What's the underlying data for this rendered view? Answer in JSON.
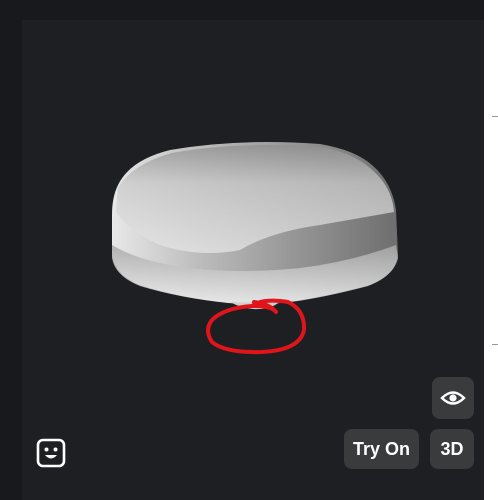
{
  "viewer": {
    "buttons": {
      "try_on_label": "Try On",
      "three_d_label": "3D"
    },
    "icons": {
      "view_toggle": "eye-icon",
      "emote": "smiley-face-icon"
    },
    "colors": {
      "background": "#1e1f23",
      "button_bg": "#393b3d",
      "annotation": "#e0151b",
      "model_light": "#d9d9d9",
      "model_dark": "#7a7a7a"
    }
  }
}
